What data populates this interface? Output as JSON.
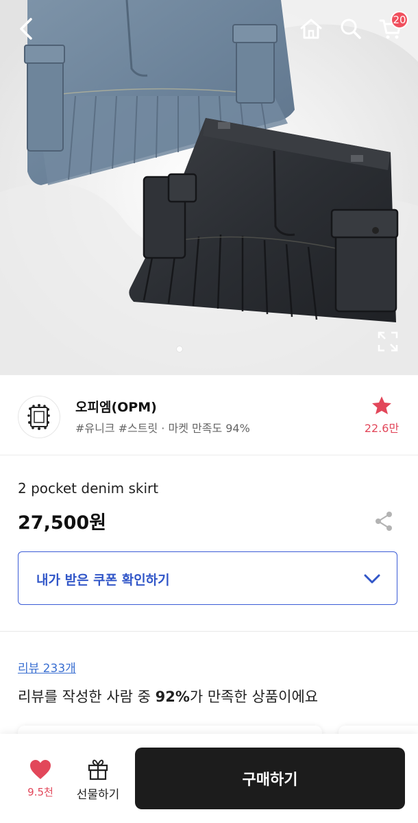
{
  "hero": {
    "cart_count": "20",
    "image_alt_icons": [
      "back-arrow-icon",
      "home-icon",
      "search-icon",
      "cart-icon",
      "expand-icon"
    ]
  },
  "shop": {
    "name": "오피엠(OPM)",
    "tags": "#유니크 #스트릿 · 마켓 만족도 94%",
    "favorite_count": "22.6만"
  },
  "product": {
    "name": "2 pocket denim skirt",
    "price": "27,500원"
  },
  "coupon": {
    "label": "내가 받은 쿠폰 확인하기"
  },
  "review": {
    "link": "리뷰 233개",
    "summary_prefix": "리뷰를 작성한 사람 중 ",
    "summary_percent": "92%",
    "summary_suffix": "가 만족한 상품이에요"
  },
  "bottom_bar": {
    "like_count": "9.5천",
    "gift_label": "선물하기",
    "buy_label": "구매하기"
  },
  "colors": {
    "accent_blue": "#3156c8",
    "heart_red": "#e2475a",
    "buy_button": "#1c1c1c",
    "badge_red": "#f0505e"
  }
}
